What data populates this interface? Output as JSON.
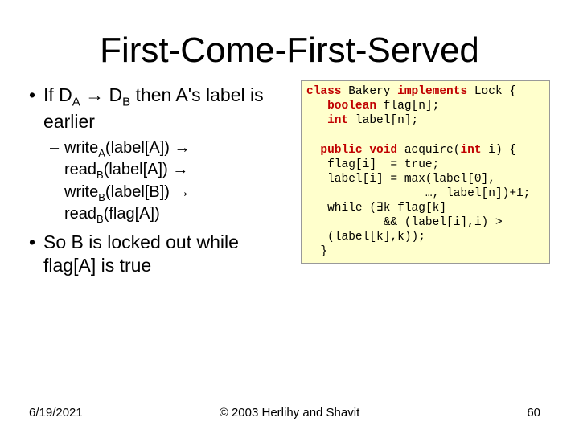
{
  "title": "First-Come-First-Served",
  "bullets": {
    "b1_pre": "If D",
    "b1_subA": "A",
    "b1_arrow": " → ",
    "b1_mid1": "D",
    "b1_subB": "B",
    "b1_post": " then A's label is earlier",
    "b2_w1a": "write",
    "b2_w1s": "A",
    "b2_w1b": "(label[A]) → read",
    "b2_w2s": "B",
    "b2_w2b": "(label[A]) → write",
    "b2_w3s": "B",
    "b2_w3b": "(label[B]) → read",
    "b2_w4s": "B",
    "b2_w4b": "(flag[A])",
    "b3": "So B is locked out while flag[A] is true"
  },
  "code": {
    "l1a": "class ",
    "l1b": "Bakery ",
    "l1c": "implements ",
    "l1d": "Lock {",
    "l2a": "   boolean ",
    "l2b": "flag[n];",
    "l3a": "   int ",
    "l3b": "label[n];",
    "blank": "",
    "l4a": "  public void ",
    "l4b": "acquire(",
    "l4c": "int ",
    "l4d": "i) {",
    "l5": "   flag[i]  = true;",
    "l6": "   label[i] = max(label[0],",
    "l7": "                 …, label[n])+1;",
    "l8a": "   while (",
    "l8b": "∃",
    "l8c": "k flag[k]",
    "l9": "           && (label[i],i) >",
    "l10": "   (label[k],k));",
    "l11": "  }"
  },
  "footer": {
    "date": "6/19/2021",
    "center": "© 2003 Herlihy and Shavit",
    "page": "60"
  }
}
